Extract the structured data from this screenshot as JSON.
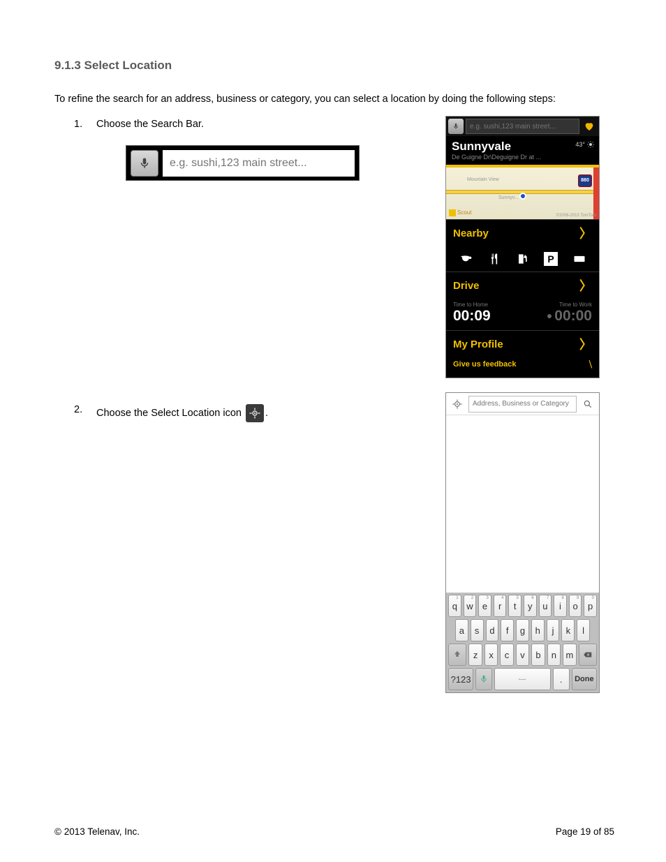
{
  "heading": "9.1.3 Select Location",
  "intro": "To refine the search for an address, business or category, you can select a location by doing the following steps:",
  "steps": {
    "s1": {
      "num": "1.",
      "text": "Choose the Search Bar."
    },
    "s2": {
      "num": "2.",
      "text_before": "Choose the Select Location icon ",
      "text_after": "."
    }
  },
  "searchbar": {
    "placeholder": "e.g. sushi,123 main street..."
  },
  "phone1": {
    "search_placeholder": "e.g. sushi,123 main street...",
    "city": "Sunnyvale",
    "subtitle": "De Guigne Dr\\Deguigne Dr at ...",
    "temp": "43°",
    "map": {
      "shield": "880",
      "label_mv": "Mountain View",
      "label_sv": "Sunnyv...",
      "scout": "Scout",
      "attrib": "©2006-2013 TomTom"
    },
    "nearby": "Nearby",
    "parking": "P",
    "drive": "Drive",
    "home_lbl": "Time to Home",
    "work_lbl": "Time to Work",
    "home_time": "00:09",
    "work_time": "00:00",
    "profile": "My Profile",
    "feedback": "Give us feedback"
  },
  "phone2": {
    "placeholder": "Address, Business or Category",
    "keyboard": {
      "row1": [
        {
          "k": "q",
          "s": "1"
        },
        {
          "k": "w",
          "s": "2"
        },
        {
          "k": "e",
          "s": "3"
        },
        {
          "k": "r",
          "s": "4"
        },
        {
          "k": "t",
          "s": "5"
        },
        {
          "k": "y",
          "s": "6"
        },
        {
          "k": "u",
          "s": "7"
        },
        {
          "k": "i",
          "s": "8"
        },
        {
          "k": "o",
          "s": "9"
        },
        {
          "k": "p",
          "s": "0"
        }
      ],
      "row2": [
        "a",
        "s",
        "d",
        "f",
        "g",
        "h",
        "j",
        "k",
        "l"
      ],
      "row3": [
        "z",
        "x",
        "c",
        "v",
        "b",
        "n",
        "m"
      ],
      "numkey": "?123",
      "dotkey": ".",
      "done": "Done"
    }
  },
  "footer": {
    "copyright": "© 2013 Telenav, Inc.",
    "page": "Page 19 of 85"
  }
}
